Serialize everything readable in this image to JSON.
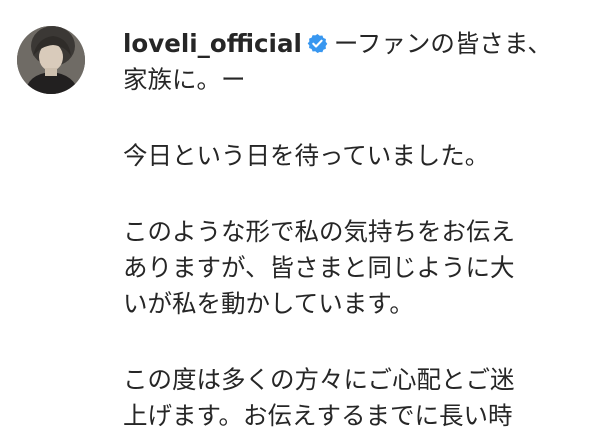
{
  "post": {
    "username": "loveli_official",
    "verified": true,
    "verified_icon": "verified-badge-icon",
    "colors": {
      "verified_blue": "#3897f0",
      "text": "#262626"
    },
    "caption": {
      "line_1": "ーファンの皆さま、",
      "line_2": "家族に。ー",
      "paragraph_1": [
        "今日という日を待っていました。"
      ],
      "paragraph_2": [
        "このような形で私の気持ちをお伝え",
        "ありますが、皆さまと同じように大",
        "いが私を動かしています。"
      ],
      "paragraph_3": [
        "この度は多くの方々にご心配とご迷",
        "上げます。お伝えするまでに長い時"
      ]
    }
  }
}
